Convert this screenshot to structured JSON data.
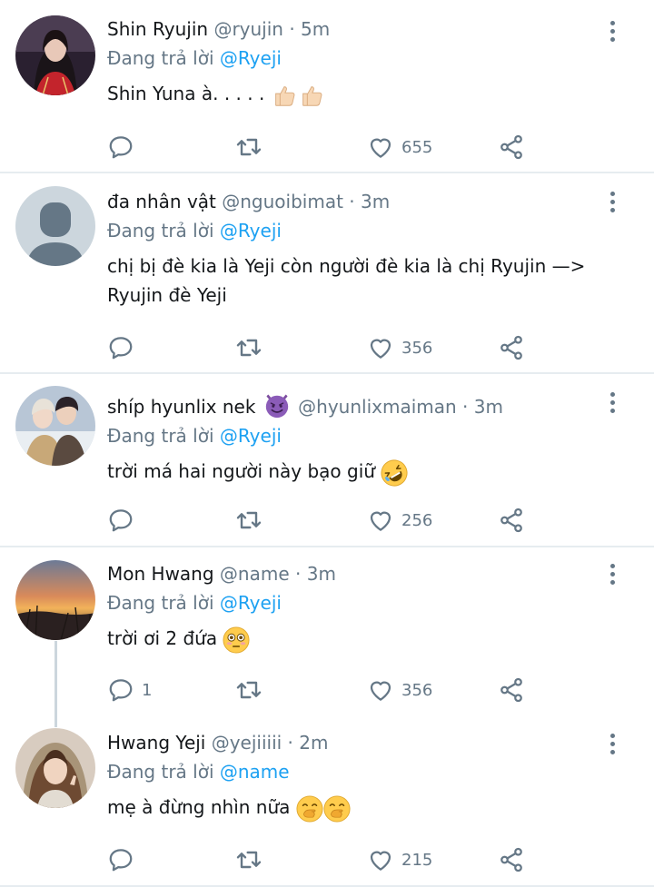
{
  "reply_prefix": "Đang trả lời",
  "tweets": [
    {
      "name": "Shin Ryujin",
      "handle": "@ryujin · 5m",
      "replying_to": "@Ryeji",
      "text": "Shin Yuna à. . . . .",
      "emojis": [
        "thumbs-up",
        "thumbs-up"
      ],
      "reply_count": "",
      "like_count": "655"
    },
    {
      "name": "đa nhân vật",
      "handle": "@nguoibimat · 3m",
      "replying_to": "@Ryeji",
      "text": "chị bị đè kia là Yeji còn người đè kia là chị Ryujin —> Ryujin đè Yeji",
      "emojis": [],
      "reply_count": "",
      "like_count": "356"
    },
    {
      "name": "shíp hyunlix nek",
      "name_emoji": "smiling-devil",
      "handle": "@hyunlixmaiman · 3m",
      "replying_to": "@Ryeji",
      "text": "trời má hai người này bạo giữ",
      "emojis": [
        "rolling-laughing"
      ],
      "reply_count": "",
      "like_count": "256"
    },
    {
      "name": "Mon Hwang",
      "handle": "@name · 3m",
      "replying_to": "@Ryeji",
      "text": "trời ơi 2 đứa",
      "emojis": [
        "flushed-face"
      ],
      "reply_count": "1",
      "like_count": "356"
    },
    {
      "name": "Hwang Yeji",
      "handle": "@yejiiiii · 2m",
      "replying_to": "@name",
      "text": "mẹ à đừng nhìn nữa",
      "emojis": [
        "hand-over-mouth",
        "hand-over-mouth"
      ],
      "reply_count": "",
      "like_count": "215"
    }
  ],
  "colors": {
    "accent": "#1da1f2",
    "muted": "#657786",
    "divider": "#e6ecf0"
  }
}
